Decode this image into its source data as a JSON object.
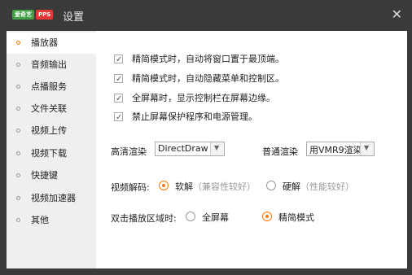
{
  "window": {
    "title": "设置",
    "logo_left": "爱奇艺",
    "logo_right": "PPS"
  },
  "sidebar": {
    "items": [
      {
        "label": "播放器",
        "active": true
      },
      {
        "label": "音频输出"
      },
      {
        "label": "点播服务"
      },
      {
        "label": "文件关联"
      },
      {
        "label": "视频上传"
      },
      {
        "label": "视频下载"
      },
      {
        "label": "快捷键"
      },
      {
        "label": "视频加速器"
      },
      {
        "label": "其他"
      }
    ]
  },
  "player": {
    "checkboxes": [
      {
        "label": "精简模式时，自动将窗口置于最顶端。",
        "checked": true
      },
      {
        "label": "精简模式时，自动隐藏菜单和控制区。",
        "checked": true
      },
      {
        "label": "全屏幕时，显示控制栏在屏幕边缘。",
        "checked": true
      },
      {
        "label": "禁止屏幕保护程序和电源管理。",
        "checked": true
      }
    ],
    "hd_render": {
      "label": "高清渲染",
      "value": "DirectDraw"
    },
    "normal_render": {
      "label": "普通渲染",
      "value": "用VMR9渲染"
    },
    "decode": {
      "label": "视频解码:",
      "soft": "软解",
      "soft_hint": "（兼容性较好）",
      "hard": "硬解",
      "hard_hint": "（性能较好）",
      "selected": "soft"
    },
    "dblclick": {
      "label": "双击播放区域时:",
      "fullscreen": "全屏幕",
      "compact": "精简模式",
      "selected": "compact"
    }
  },
  "colors": {
    "accent": "#ff7a00",
    "titlebar": "#3a3a3a"
  }
}
